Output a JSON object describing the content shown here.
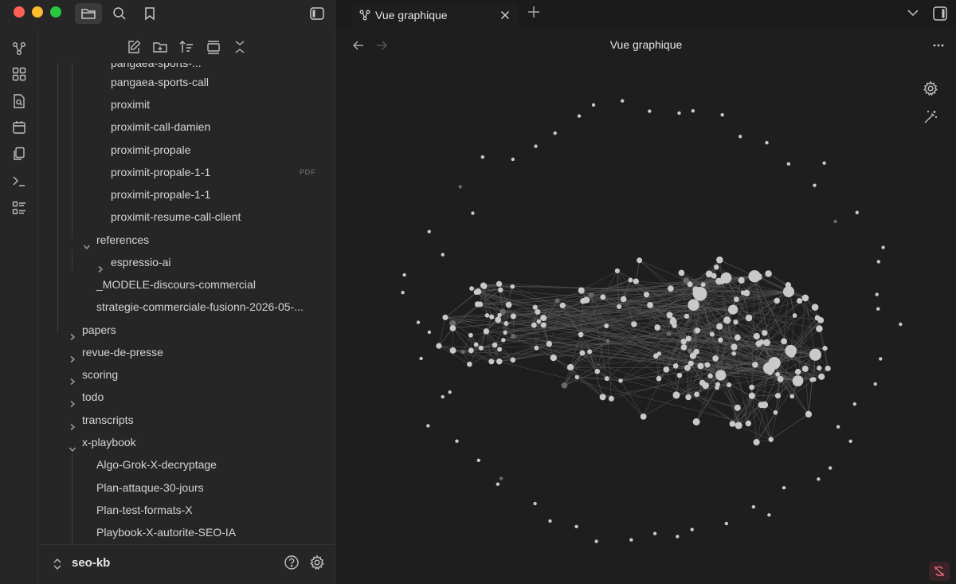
{
  "app": {
    "tab_title": "Vue graphique",
    "view_title": "Vue graphique"
  },
  "explorer": {
    "partial_top_item": "pangaea-sports-...",
    "items": [
      {
        "label": "pangaea-sports-call",
        "depth": 2,
        "type": "file"
      },
      {
        "label": "proximit",
        "depth": 2,
        "type": "file"
      },
      {
        "label": "proximit-call-damien",
        "depth": 2,
        "type": "file"
      },
      {
        "label": "proximit-propale",
        "depth": 2,
        "type": "file"
      },
      {
        "label": "proximit-propale-1-1",
        "depth": 2,
        "type": "file",
        "badge": "PDF"
      },
      {
        "label": "proximit-propale-1-1",
        "depth": 2,
        "type": "file"
      },
      {
        "label": "proximit-resume-call-client",
        "depth": 2,
        "type": "file"
      },
      {
        "label": "references",
        "depth": 1,
        "type": "folder-open"
      },
      {
        "label": "espressio-ai",
        "depth": 2,
        "type": "folder"
      },
      {
        "label": "_MODELE-discours-commercial",
        "depth": 1,
        "type": "file"
      },
      {
        "label": "strategie-commerciale-fusionn-2026-05-...",
        "depth": 1,
        "type": "file"
      },
      {
        "label": "papers",
        "depth": 0,
        "type": "folder"
      },
      {
        "label": "revue-de-presse",
        "depth": 0,
        "type": "folder"
      },
      {
        "label": "scoring",
        "depth": 0,
        "type": "folder"
      },
      {
        "label": "todo",
        "depth": 0,
        "type": "folder"
      },
      {
        "label": "transcripts",
        "depth": 0,
        "type": "folder"
      },
      {
        "label": "x-playbook",
        "depth": 0,
        "type": "folder-open"
      },
      {
        "label": "Algo-Grok-X-decryptage",
        "depth": 1,
        "type": "file"
      },
      {
        "label": "Plan-attaque-30-jours",
        "depth": 1,
        "type": "file"
      },
      {
        "label": "Plan-test-formats-X",
        "depth": 1,
        "type": "file"
      },
      {
        "label": "Playbook-X-autorite-SEO-IA",
        "depth": 1,
        "type": "file"
      }
    ]
  },
  "vault": {
    "name": "seo-kb"
  },
  "icons": {
    "ribbon": [
      "graph-icon",
      "canvas-icon",
      "search-file-icon",
      "calendar-icon",
      "copy-icon",
      "terminal-icon",
      "list-icon"
    ],
    "explorer_toolbar": [
      "new-note-icon",
      "new-folder-icon",
      "sort-icon",
      "collapse-view-icon",
      "collapse-all-icon"
    ]
  },
  "colors": {
    "node": "#c9c9c9",
    "node_dim": "#6a6a6a",
    "edge": "#5a5a5a",
    "traffic_red": "#fe5f57",
    "traffic_yellow": "#febc2e",
    "traffic_green": "#28c840"
  }
}
